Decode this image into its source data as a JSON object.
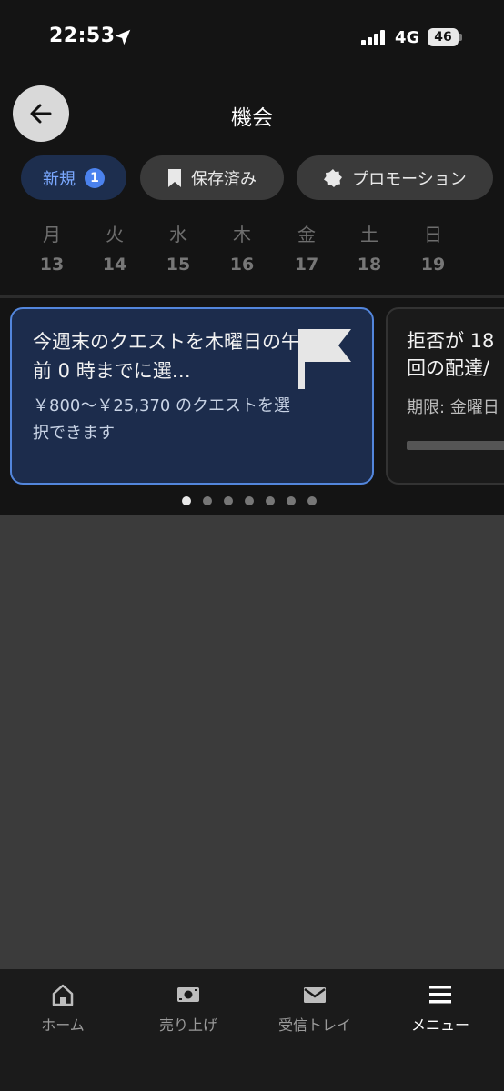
{
  "status_bar": {
    "time": "22:53",
    "network": "4G",
    "battery": "46"
  },
  "header": {
    "title": "機会"
  },
  "filters": {
    "new_label": "新規",
    "new_count": "1",
    "saved_label": "保存済み",
    "promo_label": "プロモーション"
  },
  "week": [
    {
      "name": "月",
      "date": "13"
    },
    {
      "name": "火",
      "date": "14"
    },
    {
      "name": "水",
      "date": "15"
    },
    {
      "name": "木",
      "date": "16"
    },
    {
      "name": "金",
      "date": "17"
    },
    {
      "name": "土",
      "date": "18"
    },
    {
      "name": "日",
      "date": "19"
    }
  ],
  "cards": [
    {
      "title": "今週末のクエストを木曜日の午前 0 時までに選…",
      "subtitle": "￥800～￥25,370 のクエストを選択できます",
      "icon": "flag-icon"
    },
    {
      "title_line1": "拒否が 18",
      "title_line2": "回の配達/",
      "subtitle": "期限: 金曜日"
    }
  ],
  "carousel": {
    "pages": 7,
    "active": 0
  },
  "bottom_nav": [
    {
      "label": "ホーム",
      "icon": "home-icon"
    },
    {
      "label": "売り上げ",
      "icon": "earnings-icon"
    },
    {
      "label": "受信トレイ",
      "icon": "inbox-icon"
    },
    {
      "label": "メニュー",
      "icon": "menu-icon"
    }
  ],
  "colors": {
    "background": "#141414",
    "card_bg": "#1c2c4c",
    "card_border": "#5386dc",
    "accent": "#4b82ee"
  }
}
